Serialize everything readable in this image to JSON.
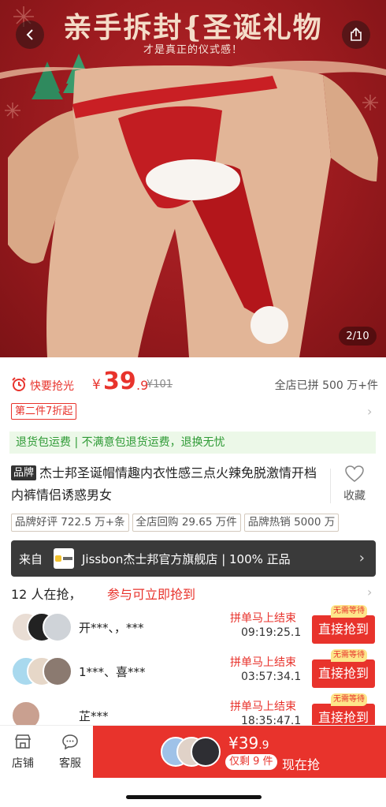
{
  "hero": {
    "title": "亲手拆封{圣诞礼物",
    "subtitle": "才是真正的仪式感！",
    "image_counter": "2/10"
  },
  "price": {
    "flash_label": "快要抢光",
    "currency": "¥",
    "integer": "39",
    "decimal": ".9",
    "original": "¥101",
    "group_count": "全店已拼 500 万+件"
  },
  "promo": {
    "badge": "第二件7折起"
  },
  "guarantee": "退货包运费 | 不满意包退货运费，退换无忧",
  "product": {
    "brand_tag": "品牌",
    "title": "杰士邦圣诞帽情趣内衣性感三点火辣免脱激情开档内裤情侣诱惑男女",
    "favorite_label": "收藏"
  },
  "tags": [
    "品牌好评 722.5 万+条",
    "全店回购 29.65 万件",
    "品牌热销 5000 万"
  ],
  "store": {
    "from_label": "来自",
    "name": "Jissbon杰士邦官方旗舰店 | 100% 正品"
  },
  "group_buy": {
    "count_label": "12 人在抢，",
    "cta": "参与可立即抢到",
    "rows": [
      {
        "names": "开***、，***",
        "status": "拼单马上结束",
        "time": "09:19:25.1",
        "button": "直接抢到",
        "badge": "无需等待"
      },
      {
        "names": "1***、喜***",
        "status": "拼单马上结束",
        "time": "03:57:34.1",
        "button": "直接抢到",
        "badge": "无需等待"
      },
      {
        "names": "芷***",
        "status": "拼单马上结束",
        "time": "18:35:47.1",
        "button": "直接抢到",
        "badge": "无需等待"
      }
    ]
  },
  "bottom_bar": {
    "store_label": "店铺",
    "service_label": "客服",
    "buy_price_int": "¥39",
    "buy_price_dec": ".9",
    "remaining": "仅剩 9 件",
    "buy_now": "现在抢"
  },
  "colors": {
    "accent": "#e8332c",
    "guarantee_green": "#2e9a35",
    "hero_red": "#9a1a1e"
  }
}
